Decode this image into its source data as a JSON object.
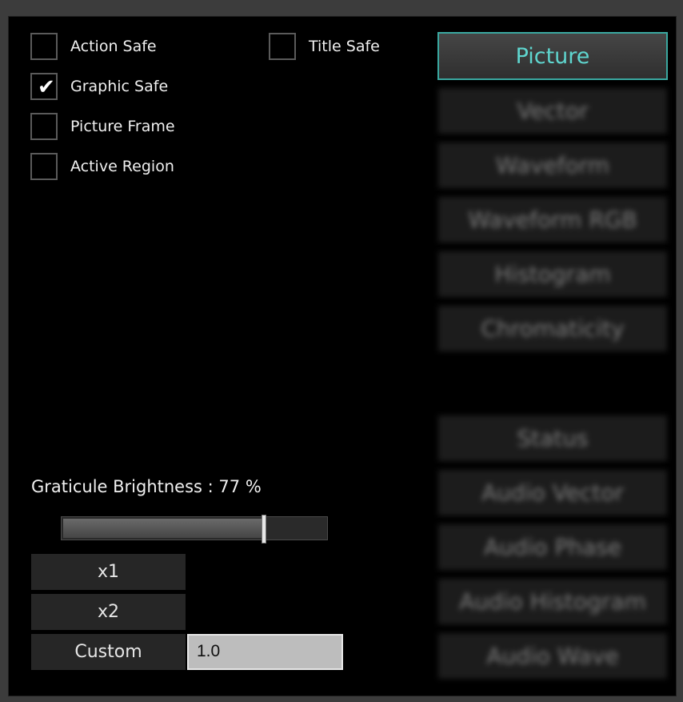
{
  "overlays": {
    "action_safe": {
      "label": "Action Safe",
      "checked": false
    },
    "title_safe": {
      "label": "Title Safe",
      "checked": false
    },
    "graphic_safe": {
      "label": "Graphic Safe",
      "checked": true
    },
    "picture_frame": {
      "label": "Picture Frame",
      "checked": false
    },
    "active_region": {
      "label": "Active Region",
      "checked": false
    },
    "check_glyph": "✔"
  },
  "modes": {
    "picture": "Picture",
    "vector": "Vector",
    "waveform": "Waveform",
    "waveform_rgb": "Waveform RGB",
    "histogram": "Histogram",
    "chromaticity": "Chromaticity",
    "status": "Status",
    "audio_vector": "Audio Vector",
    "audio_phase": "Audio Phase",
    "audio_histogram": "Audio Histogram",
    "audio_wave": "Audio Wave",
    "active": "Picture"
  },
  "graticule": {
    "label": "Graticule Brightness : ",
    "value_text": "77 %",
    "value": 0.77
  },
  "zoom": {
    "x1": "x1",
    "x2": "x2",
    "custom": "Custom",
    "custom_value": "1.0"
  },
  "colors": {
    "accent": "#3aa8a0",
    "accent_text": "#5fd6cf",
    "background": "#000000"
  }
}
